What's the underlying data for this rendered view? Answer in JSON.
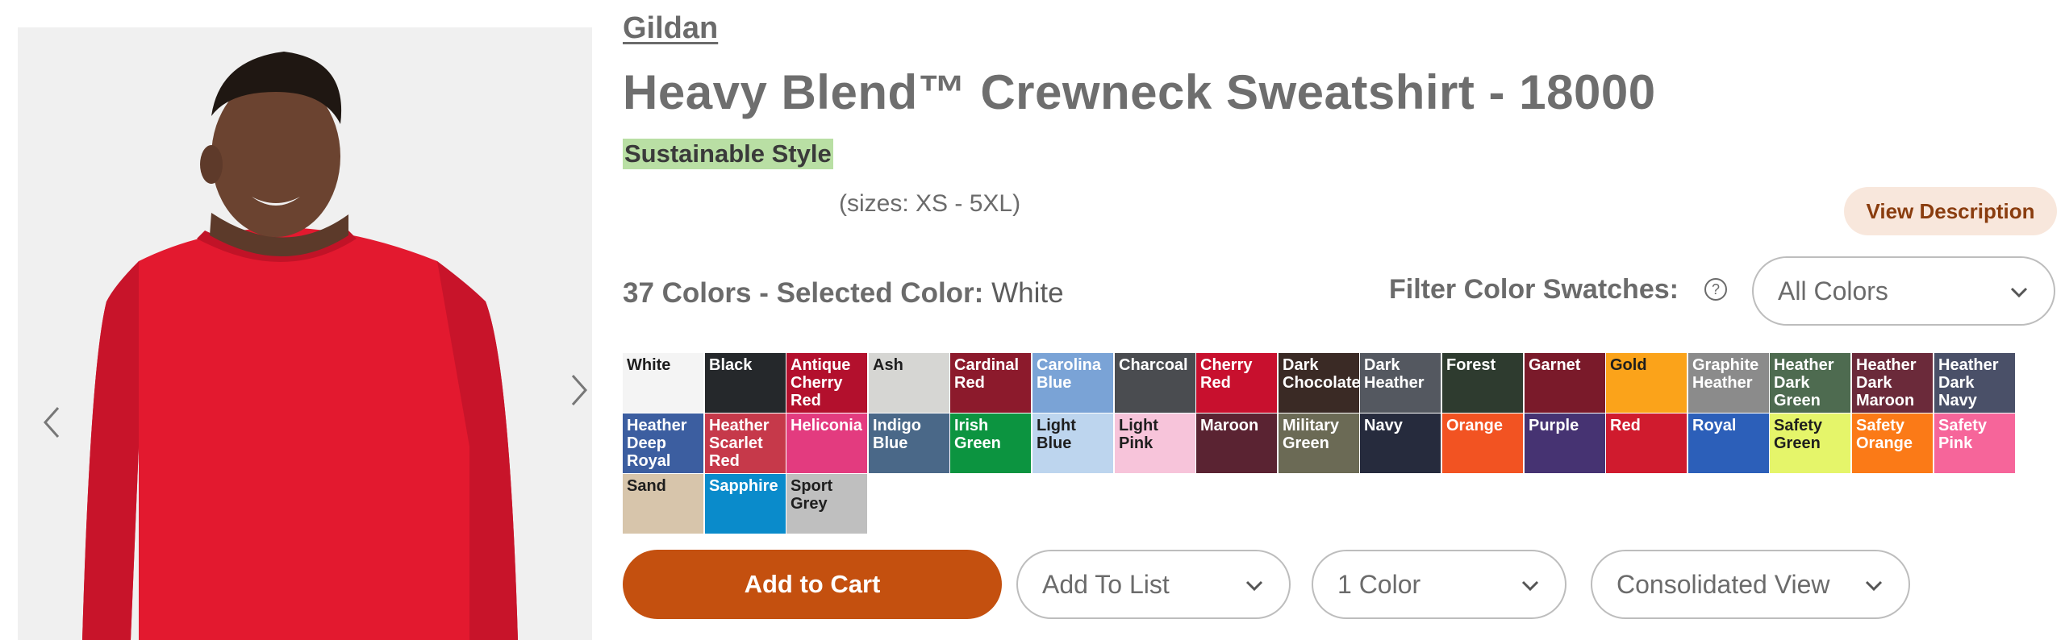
{
  "brand": "Gildan",
  "title": "Heavy Blend™ Crewneck Sweatshirt - 18000",
  "tag": "Sustainable Style",
  "sizes": "(sizes: XS - 5XL)",
  "view_description": "View Description",
  "colors_summary": {
    "count_label": "37 Colors - Selected Color:",
    "selected": "White"
  },
  "filter": {
    "label": "Filter Color Swatches:",
    "help_icon": "question-circle-icon",
    "value": "All Colors"
  },
  "swatches": [
    {
      "name": "White",
      "color": "#f4f4f4",
      "dark": true
    },
    {
      "name": "Black",
      "color": "#25282b",
      "dark": false
    },
    {
      "name": "Antique Cherry Red",
      "color": "#b3102d",
      "dark": false
    },
    {
      "name": "Ash",
      "color": "#d6d6d3",
      "dark": true
    },
    {
      "name": "Cardinal Red",
      "color": "#8c1a2c",
      "dark": false
    },
    {
      "name": "Carolina Blue",
      "color": "#7aa3d6",
      "dark": false
    },
    {
      "name": "Charcoal",
      "color": "#4a4c50",
      "dark": false
    },
    {
      "name": "Cherry Red",
      "color": "#c8102e",
      "dark": false
    },
    {
      "name": "Dark Chocolate",
      "color": "#3a2a25",
      "dark": false
    },
    {
      "name": "Dark Heather",
      "color": "#545860",
      "dark": false
    },
    {
      "name": "Forest",
      "color": "#2e3b2f",
      "dark": false
    },
    {
      "name": "Garnet",
      "color": "#7a1a2a",
      "dark": false
    },
    {
      "name": "Gold",
      "color": "#fba31a",
      "dark": true
    },
    {
      "name": "Graphite Heather",
      "color": "#8b8b8b",
      "dark": false
    },
    {
      "name": "Heather Dark Green",
      "color": "#4e6b50",
      "dark": false
    },
    {
      "name": "Heather Dark Maroon",
      "color": "#6b2a3a",
      "dark": false
    },
    {
      "name": "Heather Dark Navy",
      "color": "#4a5068",
      "dark": false
    },
    {
      "name": "Heather Deep Royal",
      "color": "#3c5ea0",
      "dark": false
    },
    {
      "name": "Heather Scarlet Red",
      "color": "#c6394a",
      "dark": false
    },
    {
      "name": "Heliconia",
      "color": "#e33b7f",
      "dark": false
    },
    {
      "name": "Indigo Blue",
      "color": "#4a6888",
      "dark": false
    },
    {
      "name": "Irish Green",
      "color": "#0c9440",
      "dark": false
    },
    {
      "name": "Light Blue",
      "color": "#bdd5ee",
      "dark": true
    },
    {
      "name": "Light Pink",
      "color": "#f7c4da",
      "dark": true
    },
    {
      "name": "Maroon",
      "color": "#5a2332",
      "dark": false
    },
    {
      "name": "Military Green",
      "color": "#6b6a55",
      "dark": false
    },
    {
      "name": "Navy",
      "color": "#262b3d",
      "dark": false
    },
    {
      "name": "Orange",
      "color": "#f25322",
      "dark": false
    },
    {
      "name": "Purple",
      "color": "#463372",
      "dark": false
    },
    {
      "name": "Red",
      "color": "#d01b2e",
      "dark": false
    },
    {
      "name": "Royal",
      "color": "#2c5fb9",
      "dark": false
    },
    {
      "name": "Safety Green",
      "color": "#e5f56a",
      "dark": true
    },
    {
      "name": "Safety Orange",
      "color": "#fb7a17",
      "dark": false
    },
    {
      "name": "Safety Pink",
      "color": "#f6659a",
      "dark": false
    },
    {
      "name": "Sand",
      "color": "#d7c5ab",
      "dark": true
    },
    {
      "name": "Sapphire",
      "color": "#0a8bcb",
      "dark": false
    },
    {
      "name": "Sport Grey",
      "color": "#bfbfbf",
      "dark": true
    }
  ],
  "buttons": {
    "add_to_cart": "Add to Cart",
    "add_to_list": "Add To List",
    "quantity": "1 Color",
    "view": "Consolidated View"
  },
  "accent_color": "#c4500f",
  "tag_color": "#b9dfa4"
}
